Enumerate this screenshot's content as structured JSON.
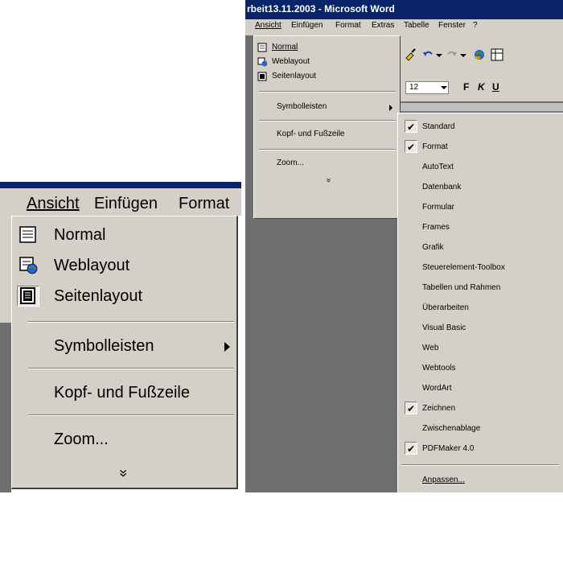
{
  "left_menu": {
    "menubar": [
      "Ansicht",
      "Einfügen",
      "Format"
    ],
    "items": [
      {
        "label": "Normal",
        "icon": "normal-view-icon"
      },
      {
        "label": "Weblayout",
        "icon": "web-layout-icon"
      },
      {
        "label": "Seitenlayout",
        "icon": "page-layout-icon"
      },
      {
        "label": "Symbolleisten"
      },
      {
        "label": "Kopf- und Fußzeile"
      },
      {
        "label": "Zoom..."
      }
    ],
    "expand": "»"
  },
  "right_window": {
    "title": "rbeit13.11.2003 - Microsoft Word",
    "menubar": [
      "Ansicht",
      "Einfügen",
      "Format",
      "Extras",
      "Tabelle",
      "Fenster",
      "?"
    ],
    "toolbar": {
      "font_size": "12",
      "bold": "F",
      "italic": "K",
      "underline": "U"
    },
    "menu": {
      "items": [
        {
          "label": "Normal",
          "icon": "normal-view-icon"
        },
        {
          "label": "Weblayout",
          "icon": "web-layout-icon"
        },
        {
          "label": "Seitenlayout",
          "icon": "page-layout-icon"
        },
        {
          "label": "Symbolleisten"
        },
        {
          "label": "Kopf- und Fußzeile"
        },
        {
          "label": "Zoom..."
        }
      ],
      "expand": "»"
    },
    "submenu": [
      {
        "label": "Standard",
        "checked": true
      },
      {
        "label": "Format",
        "checked": true
      },
      {
        "label": "AutoText",
        "checked": false
      },
      {
        "label": "Datenbank",
        "checked": false
      },
      {
        "label": "Formular",
        "checked": false
      },
      {
        "label": "Frames",
        "checked": false
      },
      {
        "label": "Grafik",
        "checked": false
      },
      {
        "label": "Steuerelement-Toolbox",
        "checked": false
      },
      {
        "label": "Tabellen und Rahmen",
        "checked": false
      },
      {
        "label": "Überarbeiten",
        "checked": false
      },
      {
        "label": "Visual Basic",
        "checked": false
      },
      {
        "label": "Web",
        "checked": false
      },
      {
        "label": "Webtools",
        "checked": false
      },
      {
        "label": "WordArt",
        "checked": false
      },
      {
        "label": "Zeichnen",
        "checked": true
      },
      {
        "label": "Zwischenablage",
        "checked": false
      },
      {
        "label": "PDFMaker 4.0",
        "checked": true
      },
      {
        "label": "Anpassen..."
      }
    ],
    "check_glyph": "✔"
  }
}
